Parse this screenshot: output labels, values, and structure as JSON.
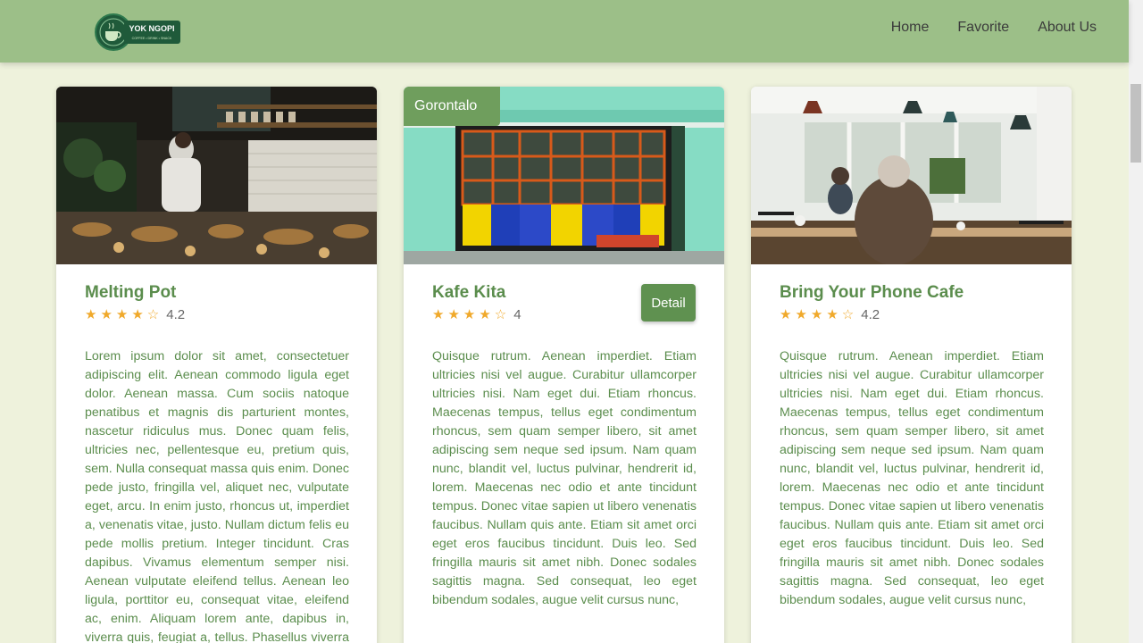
{
  "nav": {
    "logo_text": "YOK NGOPI",
    "logo_subtext": "COFFEE • DRINK • SNACK",
    "links": [
      "Home",
      "Favorite",
      "About Us"
    ]
  },
  "cards": [
    {
      "title": "Melting Pot",
      "stars": "★★★★☆",
      "rating": "4.2",
      "description": "Lorem ipsum dolor sit amet, consectetuer adipiscing elit. Aenean commodo ligula eget dolor. Aenean massa. Cum sociis natoque penatibus et magnis dis parturient montes, nascetur ridiculus mus. Donec quam felis, ultricies nec, pellentesque eu, pretium quis, sem. Nulla consequat massa quis enim. Donec pede justo, fringilla vel, aliquet nec, vulputate eget, arcu. In enim justo, rhoncus ut, imperdiet a, venenatis vitae, justo. Nullam dictum felis eu pede mollis pretium. Integer tincidunt. Cras dapibus. Vivamus elementum semper nisi. Aenean vulputate eleifend tellus. Aenean leo ligula, porttitor eu, consequat vitae, eleifend ac, enim. Aliquam lorem ante, dapibus in, viverra quis, feugiat a, tellus. Phasellus viverra nulla ut"
    },
    {
      "title": "Kafe Kita",
      "city": "Gorontalo",
      "stars": "★★★★☆",
      "rating": "4",
      "detail_label": "Detail",
      "description": "Quisque rutrum. Aenean imperdiet. Etiam ultricies nisi vel augue. Curabitur ullamcorper ultricies nisi. Nam eget dui. Etiam rhoncus. Maecenas tempus, tellus eget condimentum rhoncus, sem quam semper libero, sit amet adipiscing sem neque sed ipsum. Nam quam nunc, blandit vel, luctus pulvinar, hendrerit id, lorem. Maecenas nec odio et ante tincidunt tempus. Donec vitae sapien ut libero venenatis faucibus. Nullam quis ante. Etiam sit amet orci eget eros faucibus tincidunt. Duis leo. Sed fringilla mauris sit amet nibh. Donec sodales sagittis magna. Sed consequat, leo eget bibendum sodales, augue velit cursus nunc,"
    },
    {
      "title": "Bring Your Phone Cafe",
      "stars": "★★★★☆",
      "rating": "4.2",
      "description": "Quisque rutrum. Aenean imperdiet. Etiam ultricies nisi vel augue. Curabitur ullamcorper ultricies nisi. Nam eget dui. Etiam rhoncus. Maecenas tempus, tellus eget condimentum rhoncus, sem quam semper libero, sit amet adipiscing sem neque sed ipsum. Nam quam nunc, blandit vel, luctus pulvinar, hendrerit id, lorem. Maecenas nec odio et ante tincidunt tempus. Donec vitae sapien ut libero venenatis faucibus. Nullam quis ante. Etiam sit amet orci eget eros faucibus tincidunt. Duis leo. Sed fringilla mauris sit amet nibh. Donec sodales sagittis magna. Sed consequat, leo eget bibendum sodales, augue velit cursus nunc,"
    }
  ],
  "colors": {
    "navbar": "#9cbf88",
    "page_background": "#eef2dc",
    "accent_green": "#5b8d4d",
    "star": "#f0a92b"
  }
}
